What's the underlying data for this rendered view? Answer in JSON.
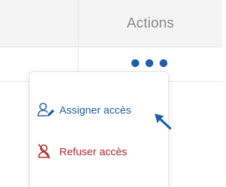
{
  "table": {
    "actions_header": "Actions"
  },
  "row_menu": {
    "trigger_icon": "more-horizontal-icon",
    "items": [
      {
        "label": "Assigner accès",
        "icon": "user-assign-icon",
        "color": "#1f5fa8"
      },
      {
        "label": "Refuser accès",
        "icon": "user-remove-icon",
        "color": "#b3262b"
      }
    ]
  },
  "colors": {
    "accent": "#1f5fa8",
    "danger": "#b3262b",
    "header_bg": "#f4f4f4",
    "header_text": "#8a8a8a"
  }
}
